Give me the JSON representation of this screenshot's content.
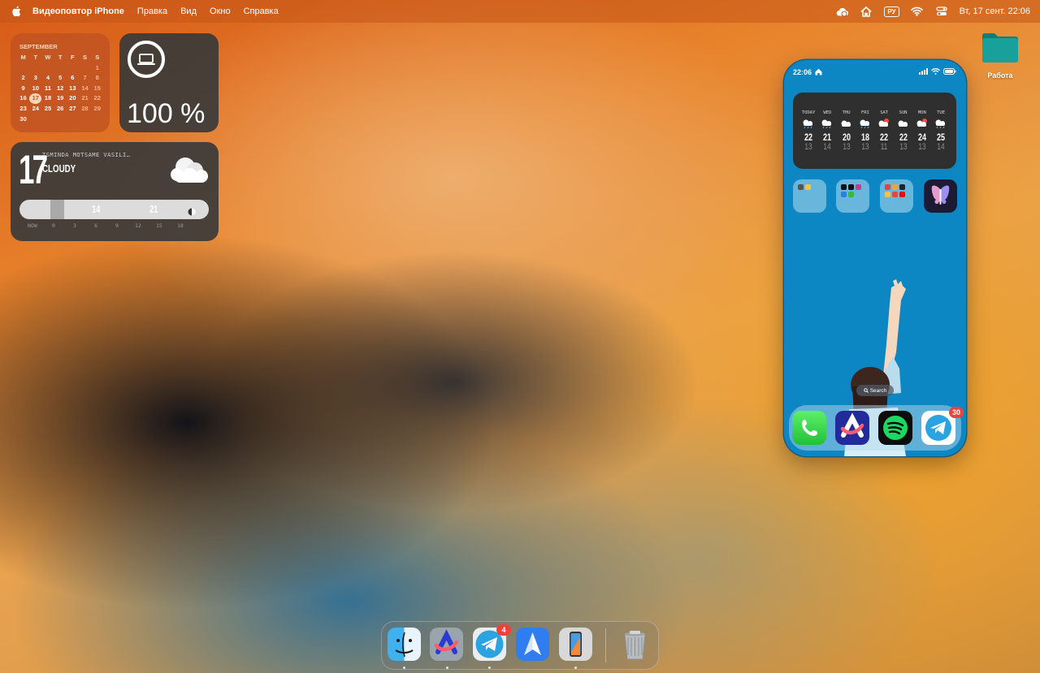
{
  "menubar": {
    "app_name": "Видеоповтор iPhone",
    "menus": [
      "Правка",
      "Вид",
      "Окно",
      "Справка"
    ],
    "input_language": "РУ",
    "clock": "Вт, 17 сент.  22:06"
  },
  "calendar_widget": {
    "month": "SEPTEMBER",
    "weekdays": [
      "M",
      "T",
      "W",
      "T",
      "F",
      "S",
      "S"
    ],
    "days": [
      "",
      "",
      "",
      "",
      "",
      "",
      "1",
      "2",
      "3",
      "4",
      "5",
      "6",
      "7",
      "8",
      "9",
      "10",
      "11",
      "12",
      "13",
      "14",
      "15",
      "16",
      "17",
      "18",
      "19",
      "20",
      "21",
      "22",
      "23",
      "24",
      "25",
      "26",
      "27",
      "28",
      "29",
      "30"
    ],
    "today": "17"
  },
  "battery_widget": {
    "percent": "100 %",
    "device_icon": "laptop-icon"
  },
  "weather_widget": {
    "temperature": "17",
    "location": "TSMINDA MOTSAME VASILI…",
    "condition": "CLOUDY",
    "bar_temp_1": "14",
    "bar_temp_2": "21",
    "hours": [
      "NOW",
      "0",
      "3",
      "6",
      "9",
      "12",
      "15",
      "18"
    ]
  },
  "desktop": {
    "folder_label": "Работа",
    "folder_color": "#14918c"
  },
  "iphone": {
    "time": "22:06",
    "forecast": [
      {
        "day": "TODAY",
        "hi": "22",
        "lo": "13",
        "icon": "rain-icon"
      },
      {
        "day": "WED",
        "hi": "21",
        "lo": "14",
        "icon": "rain-icon"
      },
      {
        "day": "THU",
        "hi": "20",
        "lo": "13",
        "icon": "cloud-icon"
      },
      {
        "day": "FRI",
        "hi": "18",
        "lo": "13",
        "icon": "rain-icon"
      },
      {
        "day": "SAT",
        "hi": "22",
        "lo": "11",
        "icon": "sun-cloud-icon"
      },
      {
        "day": "SUN",
        "hi": "22",
        "lo": "13",
        "icon": "cloud-icon"
      },
      {
        "day": "MON",
        "hi": "24",
        "lo": "13",
        "icon": "sun-cloud-icon"
      },
      {
        "day": "TUE",
        "hi": "25",
        "lo": "14",
        "icon": "rain-icon"
      }
    ],
    "search_label": "Search",
    "telegram_badge": "30",
    "wallpaper_color": "#0c87c4"
  },
  "dock": {
    "telegram_badge": "4",
    "apps": [
      "finder-icon",
      "arc-browser-icon",
      "telegram-icon",
      "spark-mail-icon",
      "iphone-mirroring-icon",
      "trash-icon"
    ]
  }
}
